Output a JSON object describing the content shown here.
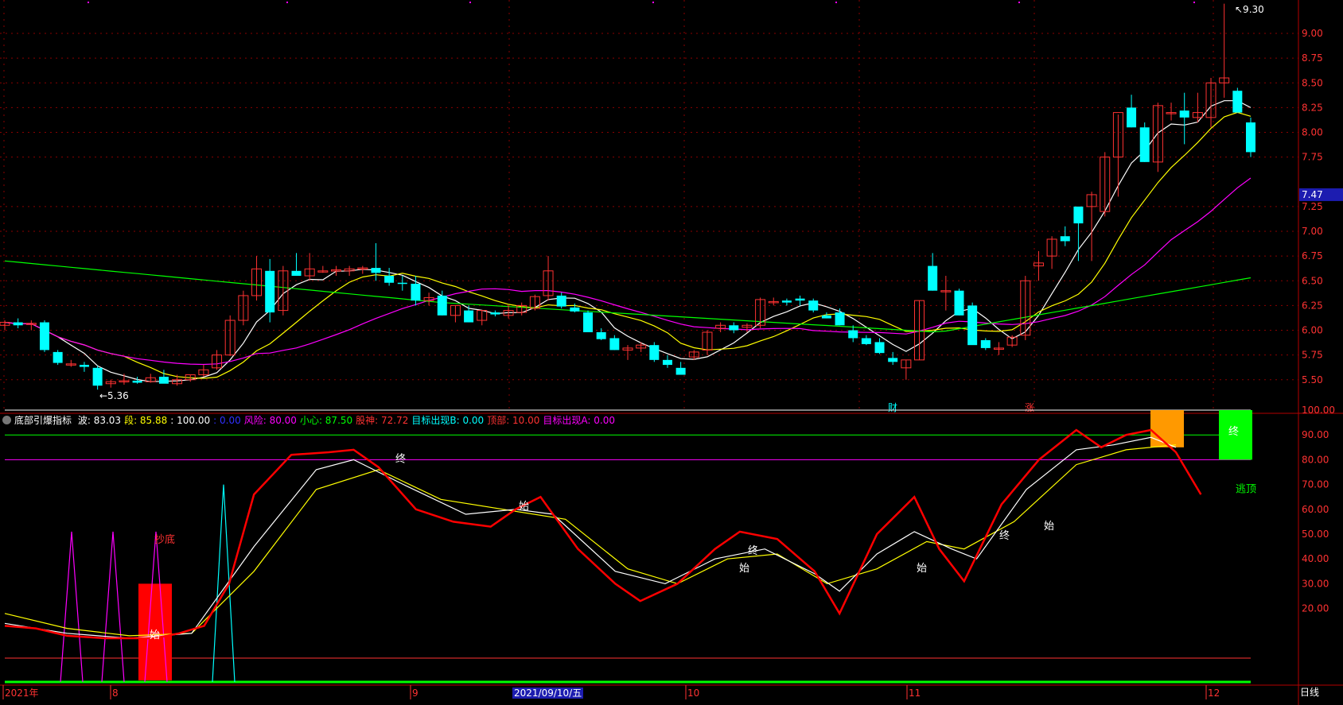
{
  "colors": {
    "up": "#ff3232",
    "down": "#00ffff",
    "ma5": "#ffffff",
    "ma10": "#ffff00",
    "ma20": "#ff00ff",
    "ma60": "#00ff00",
    "grid": "#8b0000",
    "axis": "#b40000"
  },
  "price_axis": {
    "ticks": [
      "9.00",
      "8.75",
      "8.50",
      "8.25",
      "8.00",
      "7.75",
      "7.25",
      "7.00",
      "6.75",
      "6.50",
      "6.25",
      "6.00",
      "5.75",
      "5.50"
    ],
    "current_price": "7.47",
    "max_label": "9.30",
    "min_label": "5.36"
  },
  "markers": {
    "cai": "财",
    "zhang": "涨"
  },
  "indicator": {
    "title": "底部引爆指标",
    "fields": [
      {
        "label": "波:",
        "value": "83.03",
        "color": "#ffffff"
      },
      {
        "label": "段:",
        "value": "85.88",
        "color": "#ffff00"
      },
      {
        "label": ":",
        "value": "100.00",
        "color": "#ffffff"
      },
      {
        "label": ":",
        "value": "0.00",
        "color": "#3030ff"
      },
      {
        "label": "风险:",
        "value": "80.00",
        "color": "#ff00ff"
      },
      {
        "label": "小心:",
        "value": "87.50",
        "color": "#00ff00"
      },
      {
        "label": "股神:",
        "value": "72.72",
        "color": "#ff3232"
      },
      {
        "label": "目标出现B:",
        "value": "0.00",
        "color": "#00ffff"
      },
      {
        "label": "顶部:",
        "value": "10.00",
        "color": "#ff3232"
      },
      {
        "label": "目标出现A:",
        "value": "0.00",
        "color": "#ff00ff"
      }
    ],
    "axis_ticks": [
      "100.00",
      "90.00",
      "80.00",
      "70.00",
      "60.00",
      "50.00",
      "40.00",
      "30.00",
      "20.00"
    ],
    "labels": {
      "chaodi": "抄底",
      "shi": "始",
      "zhong": "终",
      "taoding": "逃顶"
    }
  },
  "date_axis": {
    "labels": [
      "2021年",
      "8",
      "9",
      "10",
      "11",
      "12"
    ],
    "selected": "2021/09/10/五",
    "period": "日线"
  },
  "chart_data": {
    "type": "candlestick",
    "title": "",
    "ylim": [
      5.36,
      9.3
    ],
    "candles": [
      [
        6.05,
        6.1,
        6.0,
        6.08
      ],
      [
        6.08,
        6.12,
        6.02,
        6.05
      ],
      [
        6.07,
        6.1,
        6.0,
        6.07
      ],
      [
        6.08,
        6.1,
        5.78,
        5.8
      ],
      [
        5.78,
        5.8,
        5.65,
        5.67
      ],
      [
        5.66,
        5.7,
        5.63,
        5.66
      ],
      [
        5.65,
        5.68,
        5.58,
        5.63
      ],
      [
        5.62,
        5.64,
        5.4,
        5.44
      ],
      [
        5.46,
        5.5,
        5.42,
        5.48
      ],
      [
        5.48,
        5.56,
        5.45,
        5.49
      ],
      [
        5.49,
        5.53,
        5.46,
        5.47
      ],
      [
        5.48,
        5.56,
        5.47,
        5.52
      ],
      [
        5.53,
        5.6,
        5.5,
        5.46
      ],
      [
        5.46,
        5.55,
        5.44,
        5.5
      ],
      [
        5.5,
        5.55,
        5.48,
        5.55
      ],
      [
        5.55,
        5.65,
        5.53,
        5.6
      ],
      [
        5.62,
        5.8,
        5.6,
        5.75
      ],
      [
        5.75,
        6.15,
        5.74,
        6.1
      ],
      [
        6.1,
        6.4,
        6.05,
        6.35
      ],
      [
        6.35,
        6.75,
        6.3,
        6.62
      ],
      [
        6.6,
        6.72,
        6.08,
        6.18
      ],
      [
        6.2,
        6.65,
        6.15,
        6.6
      ],
      [
        6.6,
        6.78,
        6.55,
        6.55
      ],
      [
        6.55,
        6.78,
        6.5,
        6.62
      ],
      [
        6.6,
        6.65,
        6.58,
        6.6
      ],
      [
        6.6,
        6.65,
        6.55,
        6.61
      ],
      [
        6.6,
        6.65,
        6.55,
        6.62
      ],
      [
        6.62,
        6.65,
        6.57,
        6.63
      ],
      [
        6.63,
        6.88,
        6.5,
        6.58
      ],
      [
        6.55,
        6.63,
        6.45,
        6.48
      ],
      [
        6.48,
        6.55,
        6.4,
        6.47
      ],
      [
        6.47,
        6.55,
        6.25,
        6.3
      ],
      [
        6.3,
        6.38,
        6.25,
        6.33
      ],
      [
        6.35,
        6.4,
        6.15,
        6.15
      ],
      [
        6.15,
        6.25,
        6.08,
        6.25
      ],
      [
        6.2,
        6.25,
        6.08,
        6.08
      ],
      [
        6.1,
        6.2,
        6.05,
        6.2
      ],
      [
        6.18,
        6.2,
        6.14,
        6.16
      ],
      [
        6.15,
        6.25,
        6.12,
        6.2
      ],
      [
        6.18,
        6.28,
        6.15,
        6.25
      ],
      [
        6.22,
        6.36,
        6.2,
        6.34
      ],
      [
        6.35,
        6.75,
        6.3,
        6.6
      ],
      [
        6.35,
        6.38,
        6.22,
        6.24
      ],
      [
        6.23,
        6.27,
        6.18,
        6.19
      ],
      [
        6.18,
        6.2,
        5.98,
        5.98
      ],
      [
        5.98,
        6.02,
        5.9,
        5.91
      ],
      [
        5.92,
        5.95,
        5.8,
        5.8
      ],
      [
        5.8,
        5.85,
        5.7,
        5.82
      ],
      [
        5.82,
        5.88,
        5.78,
        5.85
      ],
      [
        5.85,
        5.88,
        5.68,
        5.7
      ],
      [
        5.7,
        5.75,
        5.62,
        5.65
      ],
      [
        5.62,
        5.68,
        5.56,
        5.55
      ],
      [
        5.73,
        5.8,
        5.7,
        5.78
      ],
      [
        5.8,
        6.0,
        5.75,
        5.98
      ],
      [
        6.02,
        6.08,
        5.98,
        6.05
      ],
      [
        6.05,
        6.08,
        5.97,
        6.0
      ],
      [
        6.03,
        6.07,
        5.98,
        6.05
      ],
      [
        6.05,
        6.33,
        6.02,
        6.31
      ],
      [
        6.28,
        6.33,
        6.25,
        6.29
      ],
      [
        6.3,
        6.32,
        6.25,
        6.28
      ],
      [
        6.32,
        6.35,
        6.25,
        6.3
      ],
      [
        6.3,
        6.32,
        6.18,
        6.2
      ],
      [
        6.15,
        6.18,
        6.12,
        6.12
      ],
      [
        6.18,
        6.22,
        6.05,
        6.05
      ],
      [
        6.0,
        6.05,
        5.88,
        5.92
      ],
      [
        5.92,
        5.95,
        5.85,
        5.86
      ],
      [
        5.88,
        5.92,
        5.76,
        5.77
      ],
      [
        5.72,
        5.78,
        5.65,
        5.68
      ],
      [
        5.62,
        5.7,
        5.5,
        5.7
      ],
      [
        5.7,
        6.3,
        5.7,
        6.3
      ],
      [
        6.65,
        6.78,
        6.4,
        6.4
      ],
      [
        6.4,
        6.55,
        6.2,
        6.4
      ],
      [
        6.4,
        6.42,
        6.15,
        6.15
      ],
      [
        6.25,
        6.28,
        5.95,
        5.85
      ],
      [
        5.9,
        5.92,
        5.8,
        5.82
      ],
      [
        5.82,
        5.88,
        5.75,
        5.82
      ],
      [
        5.85,
        5.95,
        5.83,
        5.93
      ],
      [
        5.95,
        6.55,
        5.9,
        6.5
      ],
      [
        6.65,
        6.8,
        6.5,
        6.68
      ],
      [
        6.75,
        6.95,
        6.62,
        6.92
      ],
      [
        6.95,
        7.05,
        6.85,
        6.9
      ],
      [
        7.25,
        7.15,
        6.7,
        7.08
      ],
      [
        7.25,
        7.4,
        6.7,
        7.37
      ],
      [
        7.2,
        7.8,
        7.15,
        7.75
      ],
      [
        7.75,
        8.18,
        7.35,
        8.2
      ],
      [
        8.25,
        8.38,
        8.05,
        8.05
      ],
      [
        8.05,
        8.1,
        7.7,
        7.7
      ],
      [
        7.7,
        8.3,
        7.6,
        8.27
      ],
      [
        8.2,
        8.3,
        8.12,
        8.2
      ],
      [
        8.22,
        8.4,
        7.88,
        8.15
      ],
      [
        8.15,
        8.4,
        8.1,
        8.2
      ],
      [
        8.15,
        8.55,
        8.05,
        8.5
      ],
      [
        8.5,
        9.3,
        8.35,
        8.55
      ],
      [
        8.42,
        8.45,
        8.2,
        8.2
      ],
      [
        8.1,
        8.15,
        7.75,
        7.8
      ]
    ],
    "indicator_series": [
      "波",
      "段",
      "股神"
    ],
    "indicator_ylim": [
      0,
      100
    ]
  }
}
